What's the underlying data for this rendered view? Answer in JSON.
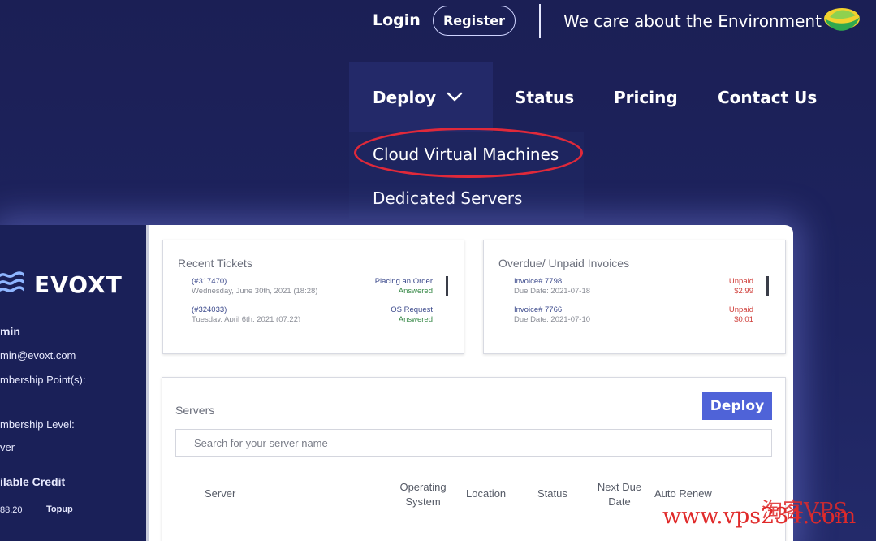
{
  "header": {
    "login": "Login",
    "register": "Register",
    "env_text": "We care about the Environment"
  },
  "nav": {
    "items": [
      {
        "label": "Deploy"
      },
      {
        "label": "Status"
      },
      {
        "label": "Pricing"
      },
      {
        "label": "Contact Us"
      }
    ],
    "dropdown": [
      {
        "label": "Cloud Virtual Machines"
      },
      {
        "label": "Dedicated Servers"
      }
    ]
  },
  "dashboard": {
    "logo": "EVOXT",
    "sidebar": {
      "name": "min",
      "email": "min@evoxt.com",
      "points_label": "mbership Point(s):",
      "points_value": "",
      "level_label": "mbership Level:",
      "level_value": "ver",
      "credit_label": "ilable Credit",
      "credit_value": "88.20",
      "topup": "Topup"
    },
    "recent_tickets": {
      "title": "Recent Tickets",
      "items": [
        {
          "id": "(#317470)",
          "date": "Wednesday, June 30th, 2021 (18:28)",
          "subject": "Placing an Order",
          "status": "Answered"
        },
        {
          "id": "(#324033)",
          "date": "Tuesday, April 6th, 2021 (07:22)",
          "subject": "OS Request",
          "status": "Answered"
        }
      ]
    },
    "invoices": {
      "title": "Overdue/ Unpaid Invoices",
      "items": [
        {
          "id": "Invoice# 7798",
          "due": "Due Date: 2021-07-18",
          "status": "Unpaid",
          "amount": "$2.99"
        },
        {
          "id": "Invoice# 7766",
          "due": "Due Date: 2021-07-10",
          "status": "Unpaid",
          "amount": "$0.01"
        }
      ]
    },
    "servers": {
      "title": "Servers",
      "deploy": "Deploy",
      "search_placeholder": "Search for your server name",
      "columns": {
        "server": "Server",
        "os_1": "Operating",
        "os_2": "System",
        "location": "Location",
        "status": "Status",
        "due_1": "Next Due",
        "due_2": "Date",
        "renew": "Auto Renew"
      }
    }
  },
  "watermark": "www.vps234.com",
  "watermark_cn": "淘客VPS",
  "colors": {
    "background": "#1b1f55",
    "highlight": "#e0293a",
    "accent_button": "#4f63d8",
    "unpaid": "#d0403c",
    "answered": "#3a8a4a"
  }
}
